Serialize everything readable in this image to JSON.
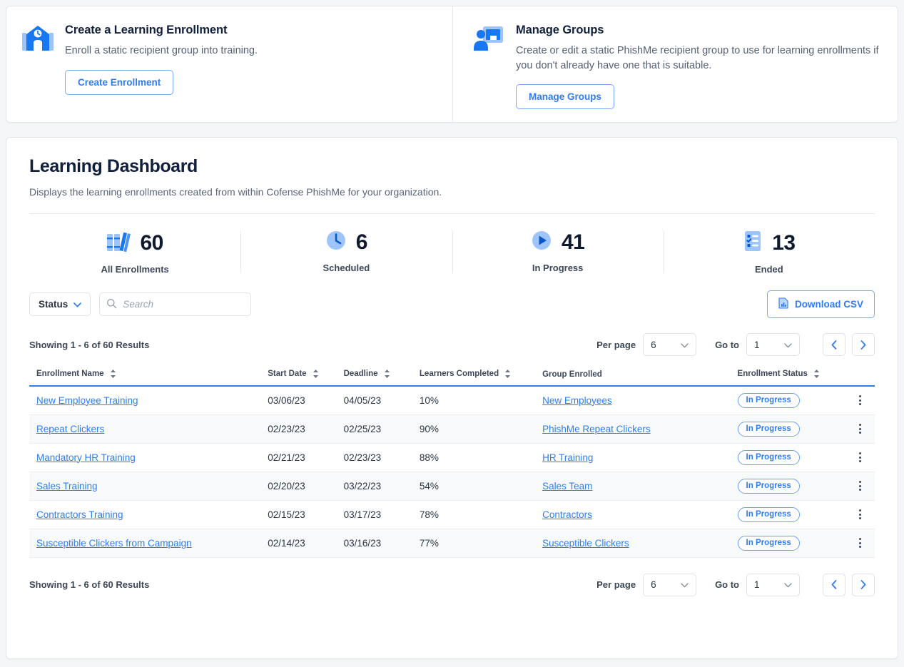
{
  "promos": [
    {
      "icon": "school-clock-icon",
      "title": "Create a Learning Enrollment",
      "description": "Enroll a static recipient group into training.",
      "button": "Create Enrollment",
      "button_name": "create-enrollment-button"
    },
    {
      "icon": "presenter-board-icon",
      "title": "Manage Groups",
      "description": "Create or edit a static PhishMe recipient group to use for learning enrollments if you don't already have one that is suitable.",
      "button": "Manage Groups",
      "button_name": "manage-groups-button"
    }
  ],
  "dashboard": {
    "title": "Learning Dashboard",
    "subtitle": "Displays the learning enrollments created from within Cofense PhishMe for your organization."
  },
  "stats": [
    {
      "icon": "books-icon",
      "value": "60",
      "label": "All Enrollments"
    },
    {
      "icon": "clock-icon",
      "value": "6",
      "label": "Scheduled"
    },
    {
      "icon": "play-icon",
      "value": "41",
      "label": "In Progress"
    },
    {
      "icon": "checklist-icon",
      "value": "13",
      "label": "Ended"
    }
  ],
  "toolbar": {
    "status_filter": "Status",
    "search_placeholder": "Search",
    "search_value": "",
    "download_csv": "Download CSV"
  },
  "pagination": {
    "showing": "Showing 1 - 6 of 60 Results",
    "per_page_label": "Per page",
    "per_page_value": "6",
    "goto_label": "Go to",
    "goto_value": "1",
    "prev_icon": "chevron-left-icon",
    "next_icon": "chevron-right-icon"
  },
  "table": {
    "columns": [
      {
        "label": "Enrollment Name",
        "sortable": true
      },
      {
        "label": "Start Date",
        "sortable": true
      },
      {
        "label": "Deadline",
        "sortable": true
      },
      {
        "label": "Learners Completed",
        "sortable": true
      },
      {
        "label": "Group Enrolled",
        "sortable": false
      },
      {
        "label": "Enrollment Status",
        "sortable": true
      }
    ],
    "rows": [
      {
        "name": "New Employee Training",
        "start": "03/06/23",
        "deadline": "04/05/23",
        "completed": "10%",
        "group": "New Employees",
        "status": "In Progress"
      },
      {
        "name": "Repeat Clickers",
        "start": "02/23/23",
        "deadline": "02/25/23",
        "completed": "90%",
        "group": "PhishMe Repeat Clickers",
        "status": "In Progress"
      },
      {
        "name": "Mandatory HR Training",
        "start": "02/21/23",
        "deadline": "02/23/23",
        "completed": "88%",
        "group": "HR Training",
        "status": "In Progress"
      },
      {
        "name": "Sales Training",
        "start": "02/20/23",
        "deadline": "03/22/23",
        "completed": "54%",
        "group": "Sales Team",
        "status": "In Progress"
      },
      {
        "name": "Contractors Training",
        "start": "02/15/23",
        "deadline": "03/17/23",
        "completed": "78%",
        "group": "Contractors",
        "status": "In Progress"
      },
      {
        "name": "Susceptible Clickers from Campaign",
        "start": "02/14/23",
        "deadline": "03/16/23",
        "completed": "77%",
        "group": "Susceptible Clickers",
        "status": "In Progress"
      }
    ]
  },
  "colors": {
    "accent": "#2f7df4",
    "accent_light": "#9dc4fb",
    "title": "#0f1f3c",
    "page_bg": "#f4f6f8"
  }
}
